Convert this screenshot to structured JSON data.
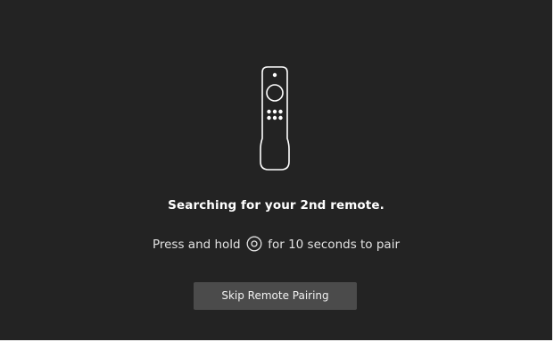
{
  "pairing": {
    "title": "Searching for your 2nd remote.",
    "instruction_before": "Press and hold",
    "instruction_icon": "select-button-icon",
    "instruction_after": "for 10 seconds to pair",
    "remote_icon": "fire-tv-remote-icon"
  },
  "actions": {
    "skip_label": "Skip Remote Pairing"
  },
  "colors": {
    "background": "#232323",
    "button": "#4b4b4b",
    "text": "#ffffff"
  }
}
